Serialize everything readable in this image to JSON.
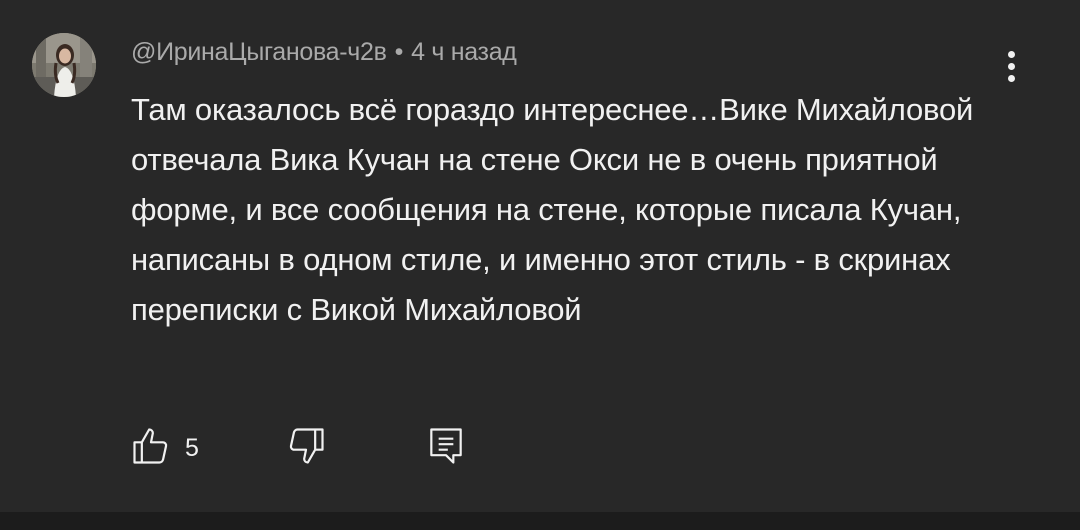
{
  "comment": {
    "author": "@ИринаЦыганова-ч2в",
    "separator": "•",
    "time": "4 ч назад",
    "text": "Там оказалось всё гораздо интереснее…Вике Михайловой отвечала Вика Кучан на стене Окси не в очень приятной форме, и все сообщения на стене, которые писала Кучан, написаны в одном стиле, и именно этот стиль - в скринах переписки с Викой Михайловой",
    "like_count": "5"
  },
  "icons": {
    "menu": "more-vert-icon",
    "like": "thumb-up-icon",
    "dislike": "thumb-down-icon",
    "reply": "comment-reply-icon"
  },
  "colors": {
    "background": "#282828",
    "primary_text": "#f1f1f1",
    "secondary_text": "#aaaaaa"
  }
}
